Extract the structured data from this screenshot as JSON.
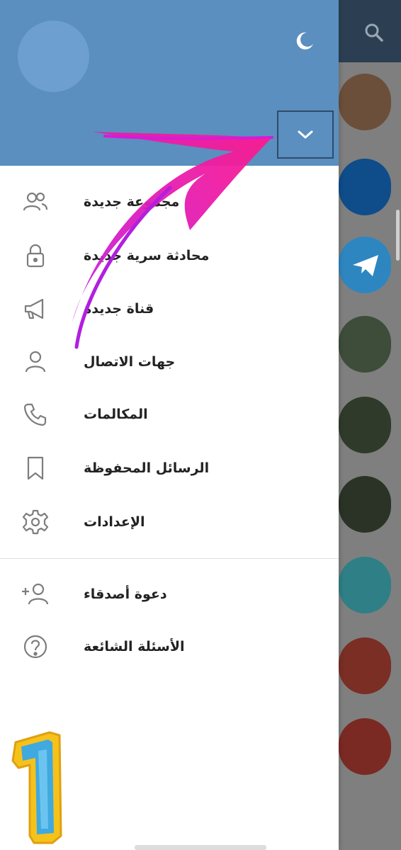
{
  "colors": {
    "drawer_header": "#5a8fbf",
    "chat_header": "#2c3f52",
    "accent_arrow": "#ee1aa6",
    "badge_fill": "#3fa9e0",
    "badge_outline": "#f5c21b"
  },
  "header": {
    "theme_icon": "moon-icon",
    "account_toggle_icon": "chevron-down-icon"
  },
  "menu": {
    "primary": [
      {
        "label": "مجموعة جديدة",
        "icon": "group-icon"
      },
      {
        "label": "محادثة سرية جديدة",
        "icon": "lock-icon"
      },
      {
        "label": "قناة جديدة",
        "icon": "megaphone-icon"
      },
      {
        "label": "جهات الاتصال",
        "icon": "person-icon"
      },
      {
        "label": "المكالمات",
        "icon": "phone-icon"
      },
      {
        "label": "الرسائل المحفوظة",
        "icon": "bookmark-icon"
      },
      {
        "label": "الإعدادات",
        "icon": "gear-icon"
      }
    ],
    "secondary": [
      {
        "label": "دعوة أصدقاء",
        "icon": "add-person-icon"
      },
      {
        "label": "الأسئلة الشائعة",
        "icon": "question-icon"
      }
    ]
  },
  "badge": {
    "number": "1"
  },
  "background_chats": {
    "search_icon": "search-icon",
    "avatars": [
      "#6b4f3a",
      "#0f4c8a",
      "#2e86c1",
      "#3d4d3a",
      "#2f3a2a",
      "#2b3326",
      "#2f7f86",
      "#7a2e24",
      "#7a2a22"
    ]
  }
}
